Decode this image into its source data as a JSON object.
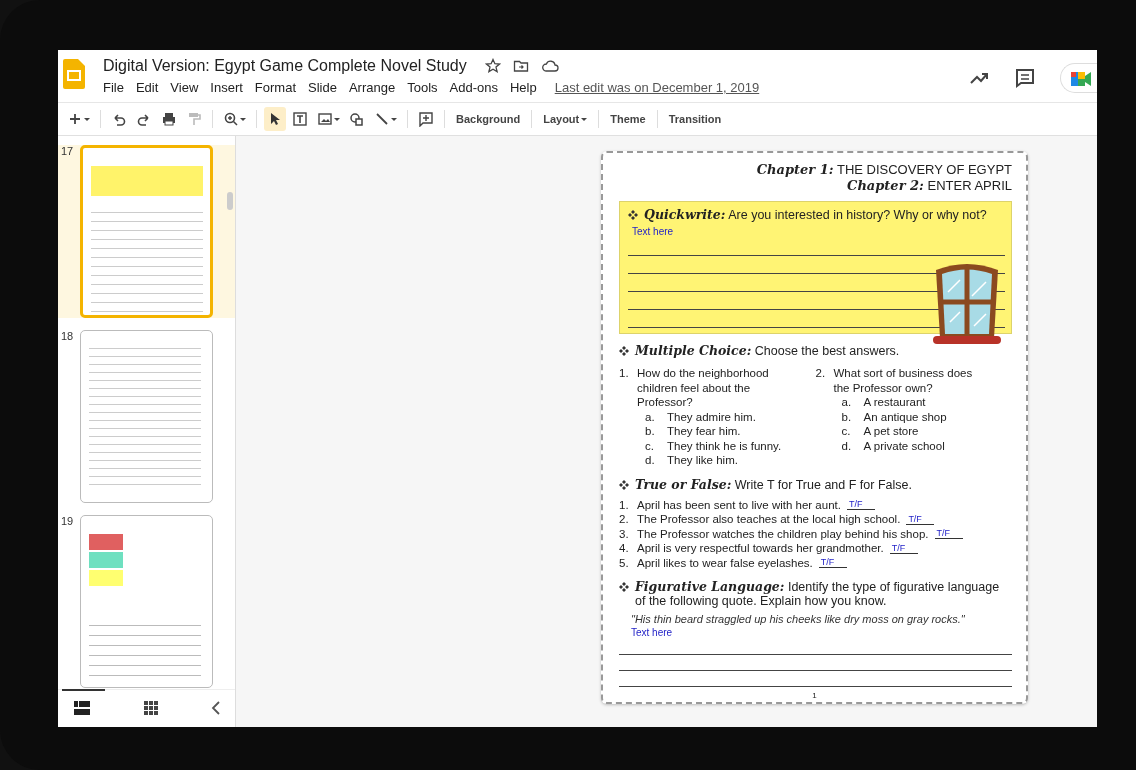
{
  "document": {
    "title": "Digital Version: Egypt Game Complete Novel Study",
    "menu": [
      "File",
      "Edit",
      "View",
      "Insert",
      "Format",
      "Slide",
      "Arrange",
      "Tools",
      "Add-ons",
      "Help"
    ],
    "last_edit": "Last edit was on December 1, 2019"
  },
  "toolbar": {
    "tools": [
      {
        "selected": false
      },
      {
        "selected": false
      },
      {
        "selected": false
      },
      {
        "selected": false
      },
      {
        "selected": false
      },
      {
        "selected": false
      },
      {
        "selected": true
      },
      {
        "selected": false
      },
      {
        "selected": false
      },
      {
        "selected": false
      },
      {
        "selected": false
      },
      {
        "selected": false
      }
    ],
    "text_buttons": [
      {
        "label": "Background",
        "dropdown": false
      },
      {
        "label": "Layout",
        "dropdown": true
      },
      {
        "label": "Theme",
        "dropdown": false
      },
      {
        "label": "Transition",
        "dropdown": false
      }
    ]
  },
  "filmstrip": {
    "slides": [
      {
        "number": "17",
        "selected": true,
        "kind": "quiz"
      },
      {
        "number": "18",
        "selected": false,
        "kind": "writing"
      },
      {
        "number": "19",
        "selected": false,
        "kind": "table"
      }
    ]
  },
  "slide": {
    "chapters": [
      {
        "label": "Chapter 1:",
        "title": "THE DISCOVERY OF EGYPT"
      },
      {
        "label": "Chapter 2:",
        "title": "ENTER APRIL"
      }
    ],
    "quickwrite": {
      "heading": "Quickwrite:",
      "prompt": "Are you interested in history? Why or why not?",
      "answer": "Text here"
    },
    "multiple_choice": {
      "heading": "Multiple Choice:",
      "prompt": "Choose the best answers.",
      "questions": [
        {
          "number": "1.",
          "text": "How do the neighborhood children feel about the Professor?",
          "options": [
            {
              "letter": "a.",
              "text": "They admire him."
            },
            {
              "letter": "b.",
              "text": "They fear him."
            },
            {
              "letter": "c.",
              "text": "They think he is funny."
            },
            {
              "letter": "d.",
              "text": "They like him."
            }
          ]
        },
        {
          "number": "2.",
          "text": "What sort of business does the Professor own?",
          "options": [
            {
              "letter": "a.",
              "text": "A restaurant"
            },
            {
              "letter": "b.",
              "text": "An antique shop"
            },
            {
              "letter": "c.",
              "text": "A pet store"
            },
            {
              "letter": "d.",
              "text": "A private school"
            }
          ]
        }
      ]
    },
    "true_false": {
      "heading": "True or False:",
      "prompt": "Write T for True and F for False.",
      "items": [
        {
          "number": "1.",
          "text": "April has been sent to live with her aunt.",
          "blank": "T/F"
        },
        {
          "number": "2.",
          "text": "The Professor also teaches at the local high school.",
          "blank": "T/F"
        },
        {
          "number": "3.",
          "text": "The Professor watches the children play behind his shop.",
          "blank": "T/F"
        },
        {
          "number": "4.",
          "text": "April is very respectful towards her grandmother.",
          "blank": "T/F"
        },
        {
          "number": "5.",
          "text": "April likes to wear false eyelashes.",
          "blank": "T/F"
        }
      ]
    },
    "figurative": {
      "heading": "Figurative Language:",
      "prompt": "Identify the type of figurative language of the following quote. Explain how you know.",
      "quote": "\"His thin beard straggled up his cheeks like dry moss on gray rocks.\"",
      "answer": "Text here"
    },
    "page_number": "1"
  }
}
